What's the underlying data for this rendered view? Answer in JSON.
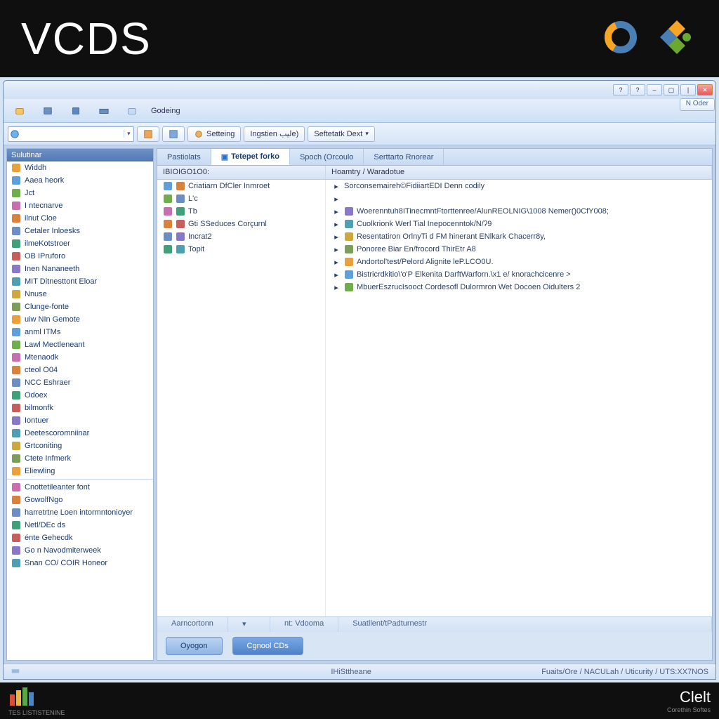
{
  "banner": {
    "brand": "VCDS"
  },
  "titlebar": {
    "tip_label": "N Oder"
  },
  "toolbar1": {
    "items": [
      "",
      "",
      "",
      "",
      ""
    ],
    "label_right": "Godeing"
  },
  "toolbar2": {
    "search_placeholder": "",
    "btn_settings": "Setteing",
    "btn_injection": "Ingstien ليبe)",
    "combo_label": "Seftetatk Dext"
  },
  "tabs": {
    "t0": "Pastiolats",
    "t1": "Tetepet forko",
    "t2": "Spoch (Orcoulo",
    "t3": "Serttarto Rnorear"
  },
  "columns": {
    "c0": "IBIOIGO1O0:",
    "c1": "Hoamtry / Waradotue"
  },
  "sidebar_header": "Sulutinar",
  "sidebar": {
    "a": [
      "Widdh",
      "Aaea heork",
      "Jct",
      "I ntecnarve",
      "ilnut Cloe",
      "Cetaler Inloesks",
      "ilmeKotstroer",
      "OB IPruforo",
      "Inen Nananeeth",
      "MIT Ditnesttont Eloar",
      "Nnuse",
      "Clunge-fonte",
      "uiw NIn Gemote",
      "anml ITMs",
      "Lawl Mectleneant",
      "Mtenaodk",
      "cteol O04",
      "NCC Eshraer",
      "Odoex",
      "bilmonfk",
      "Iontuer",
      "Deetescoromniinar",
      "Grtconiting",
      "Ctete Infmerk",
      "Eliewling"
    ],
    "b": [
      "Cnottetileanter font",
      "GowolfNgo",
      "harretrtne Loen intormntonioyer",
      "Netl/DEc ds",
      "énte Gehecdk",
      "Go n Navodmiterweek",
      "Snan CO/ COIR Honeor"
    ]
  },
  "grid_left": [
    "Criatiarn DfCler Inmroet",
    "L'c",
    "Tb",
    "Gti SSeduces Corçurnl",
    "Incrat2",
    "Topit"
  ],
  "grid_right": [
    "Sorconsemaireh©FidiiartEDI Denn codily",
    "",
    "Woerenntuh8ITinecmntFtorttenree/AlunREOLNIG\\1008 Nemer()0CfY008;",
    "Cuolkrionk Werl Tial Inepocenntok/N/ʔ9",
    "Resentatiron OrlnyTi d FM hinerant ENlkark Chacerr8y,",
    "Ponoree Biar En/frocord ThirEtr  A8",
    "Andortol'test/Pelord Alignite\nleP.LCO0U.",
    "Bistricrdkitio\\'o'P Elkenita DarftWarforn.\\x1 e/ knorachcicenre >",
    "MbuerEszrucIsooct Cordesofl Dulormron Wet Docoen Oidulters 2"
  ],
  "bottom_tabs": {
    "b0": "Aarncortonn",
    "b1": "nt: Vdooma",
    "b2": "Suatllent/tPadturnestr"
  },
  "actions": {
    "open": "Oyogon",
    "connect": "Cgnool CDs"
  },
  "status": {
    "left": "IHiSttheane",
    "right": "Fuaits/Ore / NACULah / Uticurity / UTS:XX7NOS"
  },
  "footer": {
    "left": "TES LISTISTENINE",
    "right": "Clelt",
    "right_sub": "Corethin Softes"
  }
}
